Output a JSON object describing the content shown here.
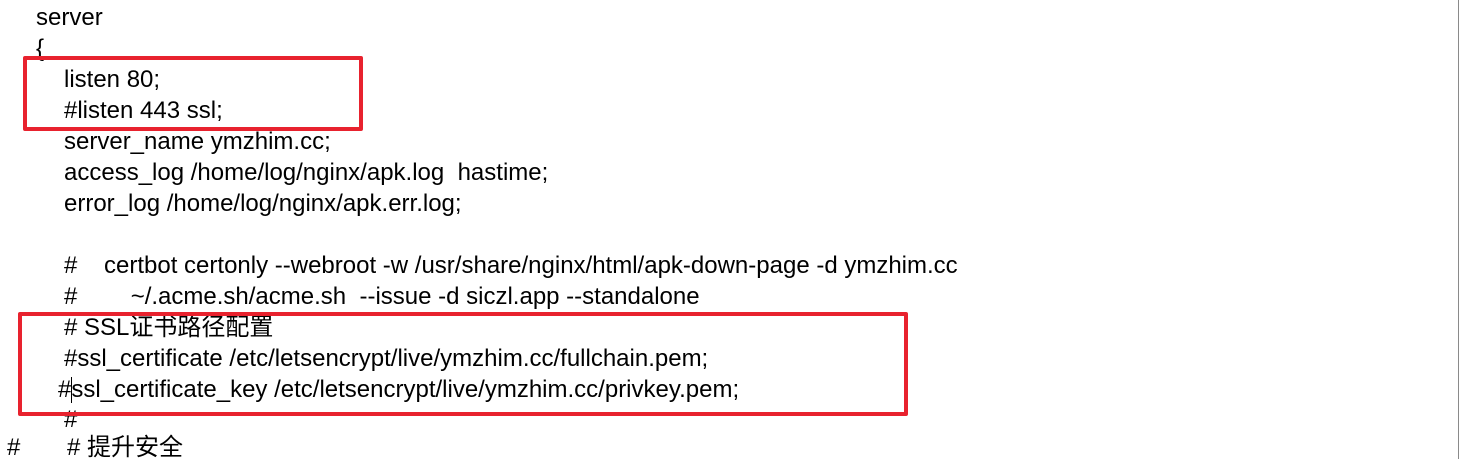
{
  "editor": {
    "lines": [
      "server",
      "{",
      "listen 80;",
      "#listen 443 ssl;",
      "server_name ymzhim.cc;",
      "access_log /home/log/nginx/apk.log  hastime;",
      "error_log /home/log/nginx/apk.err.log;",
      "#    certbot certonly --webroot -w /usr/share/nginx/html/apk-down-page -d ymzhim.cc",
      "#        ~/.acme.sh/acme.sh  --issue -d siczl.app --standalone",
      "# SSL证书路径配置",
      "#ssl_certificate /etc/letsencrypt/live/ymzhim.cc/fullchain.pem;",
      "#ssl_certificate_key /etc/letsencrypt/live/ymzhim.cc/privkey.pem;",
      "#",
      "#       # 提升安全"
    ]
  },
  "colors": {
    "highlight": "#e8222e",
    "text": "#000000",
    "background": "#ffffff"
  }
}
